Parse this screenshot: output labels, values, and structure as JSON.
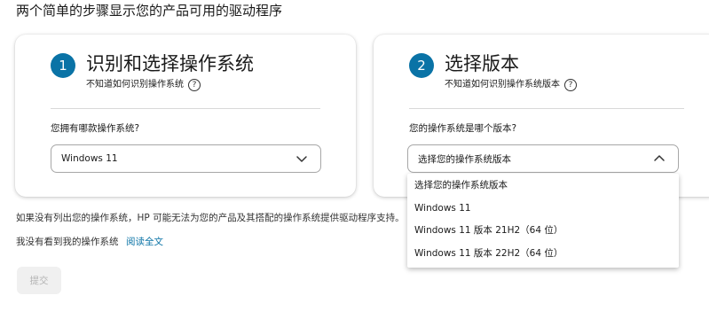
{
  "page": {
    "title": "两个简单的步骤显示您的产品可用的驱动程序"
  },
  "step1": {
    "number": "1",
    "title": "识别和选择操作系统",
    "help_text": "不知道如何识别操作系统",
    "field_label": "您拥有哪款操作系统?",
    "selected_value": "Windows 11",
    "icon": "chevron-down-icon"
  },
  "step2": {
    "number": "2",
    "title": "选择版本",
    "help_text": "不知道如何识别操作系统版本",
    "field_label": "您的操作系统是哪个版本?",
    "selected_value": "选择您的操作系统版本",
    "icon": "chevron-up-icon",
    "options": [
      "选择您的操作系统版本",
      "Windows 11",
      "Windows 11 版本 21H2（64 位）",
      "Windows 11 版本 22H2（64 位）"
    ]
  },
  "notice": "如果没有列出您的操作系统，HP 可能无法为您的产品及其搭配的操作系统提供驱动程序支持。",
  "not_seen_text": "我没有看到我的操作系统",
  "read_more_link": "阅读全文",
  "submit_label": "提交",
  "colors": {
    "accent": "#0a73a6",
    "disabled_button_bg": "#f0f0f0",
    "disabled_button_text": "#b3b3b3"
  }
}
